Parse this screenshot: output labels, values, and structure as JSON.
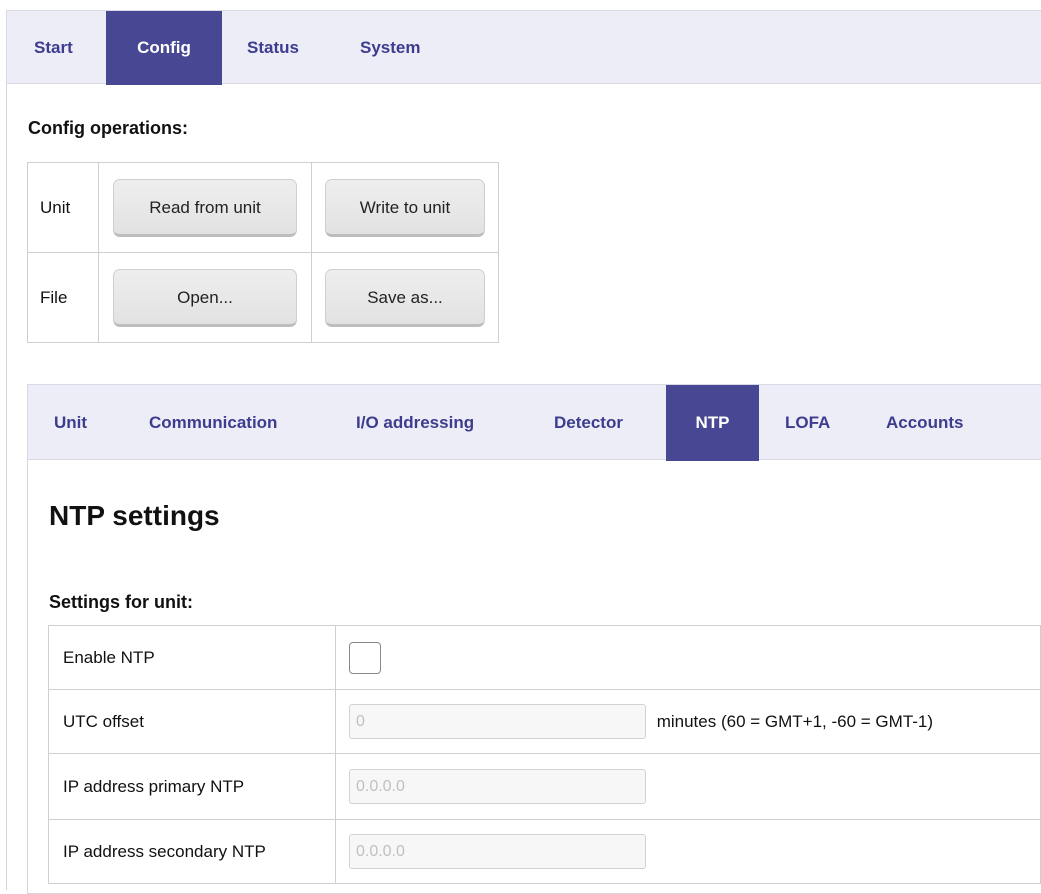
{
  "topnav": {
    "tabs": [
      {
        "label": "Start"
      },
      {
        "label": "Config"
      },
      {
        "label": "Status"
      },
      {
        "label": "System"
      }
    ],
    "active": "Config"
  },
  "config_ops": {
    "title": "Config operations:",
    "rows": [
      {
        "label": "Unit",
        "btn1": "Read from unit",
        "btn2": "Write to unit"
      },
      {
        "label": "File",
        "btn1": "Open...",
        "btn2": "Save as..."
      }
    ]
  },
  "subnav": {
    "tabs": [
      {
        "label": "Unit"
      },
      {
        "label": "Communication"
      },
      {
        "label": "I/O addressing"
      },
      {
        "label": "Detector"
      },
      {
        "label": "NTP"
      },
      {
        "label": "LOFA"
      },
      {
        "label": "Accounts"
      }
    ],
    "active": "NTP"
  },
  "ntp": {
    "title": "NTP settings",
    "subtitle": "Settings for unit:",
    "fields": {
      "enable_label": "Enable NTP",
      "enable_checked": false,
      "utc_label": "UTC offset",
      "utc_value": "0",
      "utc_note": "minutes (60 = GMT+1, -60 = GMT-1)",
      "primary_label": "IP address primary NTP",
      "primary_value": "0.0.0.0",
      "secondary_label": "IP address secondary NTP",
      "secondary_value": "0.0.0.0"
    }
  }
}
